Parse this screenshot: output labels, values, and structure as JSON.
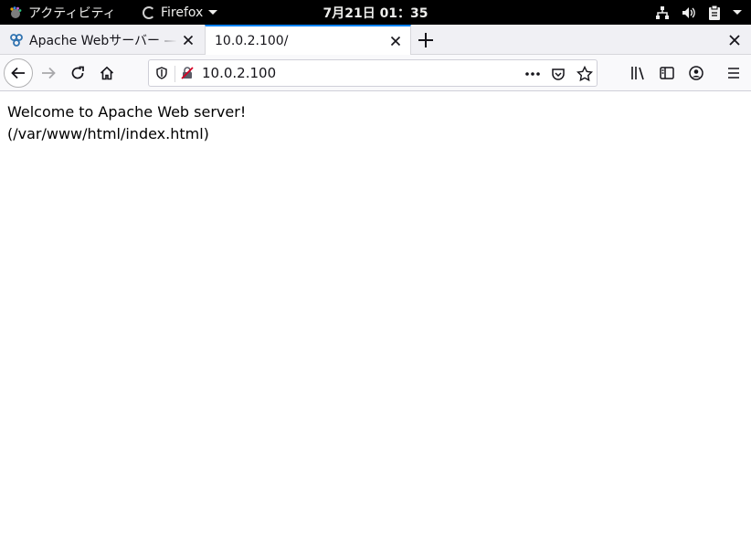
{
  "topbar": {
    "activities_label": "アクティビティ",
    "app_menu_label": "Firefox",
    "clock": "7月21日  01：35"
  },
  "tabs": [
    {
      "title": "Apache Webサーバー — Wiki",
      "active": false,
      "favicon": "apache-wiki-icon"
    },
    {
      "title": "10.0.2.100/",
      "active": true,
      "favicon": ""
    }
  ],
  "navbar": {
    "url": "10.0.2.100"
  },
  "content": {
    "line1": "Welcome to Apache Web server!",
    "line2": "(/var/www/html/index.html)"
  },
  "colors": {
    "topbar_bg": "#000000",
    "active_tab_accent": "#0a84ff",
    "insecure_lock": "#d70022"
  }
}
